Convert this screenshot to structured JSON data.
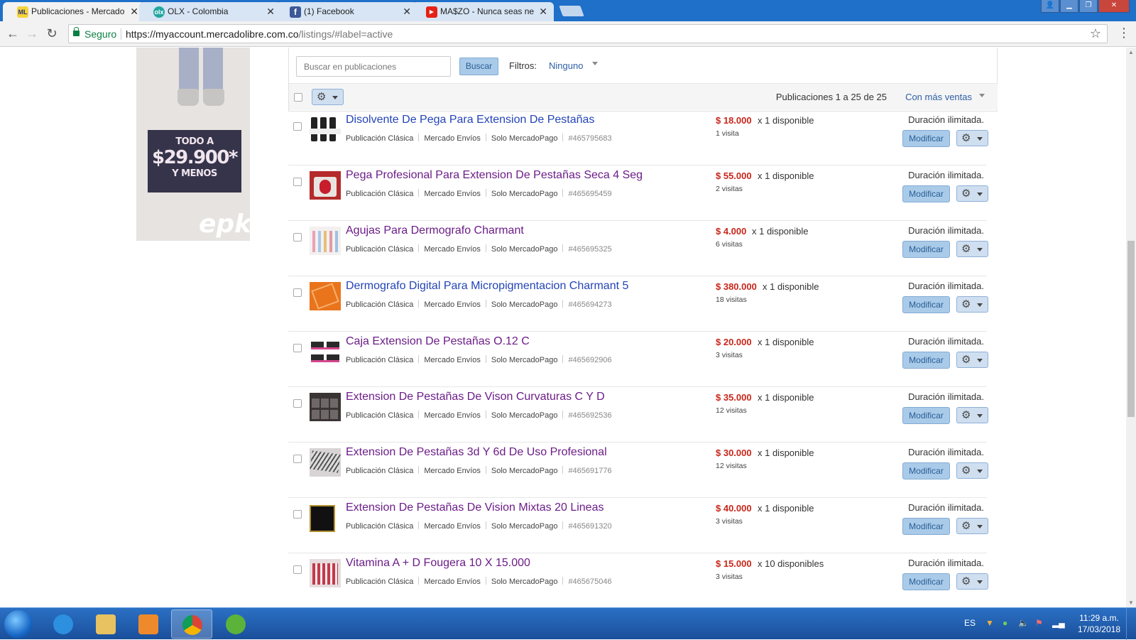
{
  "browser": {
    "tabs": [
      {
        "title": "Publicaciones - Mercado",
        "active": true,
        "favicon": "mercadolibre-icon",
        "favicon_color": "#f5d33d"
      },
      {
        "title": "OLX - Colombia",
        "active": false,
        "favicon": "olx-icon",
        "favicon_color": "#23a6a0"
      },
      {
        "title": "(1) Facebook",
        "active": false,
        "favicon": "facebook-icon",
        "favicon_color": "#3b5998"
      },
      {
        "title": "MA$ZO - Nunca seas ne",
        "active": false,
        "favicon": "youtube-icon",
        "favicon_color": "#e62117"
      }
    ],
    "secure_label": "Seguro",
    "url_host": "https://myaccount.mercadolibre.com.co",
    "url_path": "/listings/#label=active"
  },
  "ad": {
    "line1": "TODO A",
    "line2": "$29.900*",
    "line3": "Y MENOS",
    "brand": "epk"
  },
  "toolbar": {
    "search_placeholder": "Buscar en publicaciones",
    "search_button": "Buscar",
    "filters_label": "Filtros:",
    "filters_value": "Ninguno",
    "count_text": "Publicaciones 1 a 25 de 25",
    "sort_label": "Con más ventas"
  },
  "listing_labels": {
    "duration": "Duración ilimitada.",
    "modify": "Modificar",
    "tag1": "Publicación Clásica",
    "tag2": "Mercado Envíos",
    "tag3": "Solo MercadoPago"
  },
  "listings": [
    {
      "title": "Disolvente De Pega Para Extension De Pestañas",
      "title_color": "blue",
      "price": "$ 18.000",
      "available": "x 1 disponible",
      "visits": "1 visita",
      "id": "#465795683"
    },
    {
      "title": "Pega Profesional Para Extension De Pestañas Seca 4 Seg",
      "title_color": "purple",
      "price": "$ 55.000",
      "available": "x 1 disponible",
      "visits": "2 visitas",
      "id": "#465695459"
    },
    {
      "title": "Agujas Para Dermografo Charmant",
      "title_color": "purple",
      "price": "$ 4.000",
      "available": "x 1 disponible",
      "visits": "6 visitas",
      "id": "#465695325"
    },
    {
      "title": "Dermografo Digital Para Micropigmentacion Charmant 5",
      "title_color": "blue",
      "price": "$ 380.000",
      "available": "x 1 disponible",
      "visits": "18 visitas",
      "id": "#465694273"
    },
    {
      "title": "Caja Extension De Pestañas O.12 C",
      "title_color": "purple",
      "price": "$ 20.000",
      "available": "x 1 disponible",
      "visits": "3 visitas",
      "id": "#465692906"
    },
    {
      "title": "Extension De Pestañas De Vison Curvaturas C Y D",
      "title_color": "purple",
      "price": "$ 35.000",
      "available": "x 1 disponible",
      "visits": "12 visitas",
      "id": "#465692536"
    },
    {
      "title": "Extension De Pestañas 3d Y 6d De Uso Profesional",
      "title_color": "purple",
      "price": "$ 30.000",
      "available": "x 1 disponible",
      "visits": "12 visitas",
      "id": "#465691776"
    },
    {
      "title": "Extension De Pestañas De Vision Mixtas 20 Lineas",
      "title_color": "purple",
      "price": "$ 40.000",
      "available": "x 1 disponible",
      "visits": "3 visitas",
      "id": "#465691320"
    },
    {
      "title": "Vitamina A + D Fougera 10 X 15.000",
      "title_color": "purple",
      "price": "$ 15.000",
      "available": "x 10 disponibles",
      "visits": "3 visitas",
      "id": "#465675046"
    }
  ],
  "taskbar": {
    "language": "ES",
    "time": "11:29 a.m.",
    "date": "17/03/2018"
  }
}
